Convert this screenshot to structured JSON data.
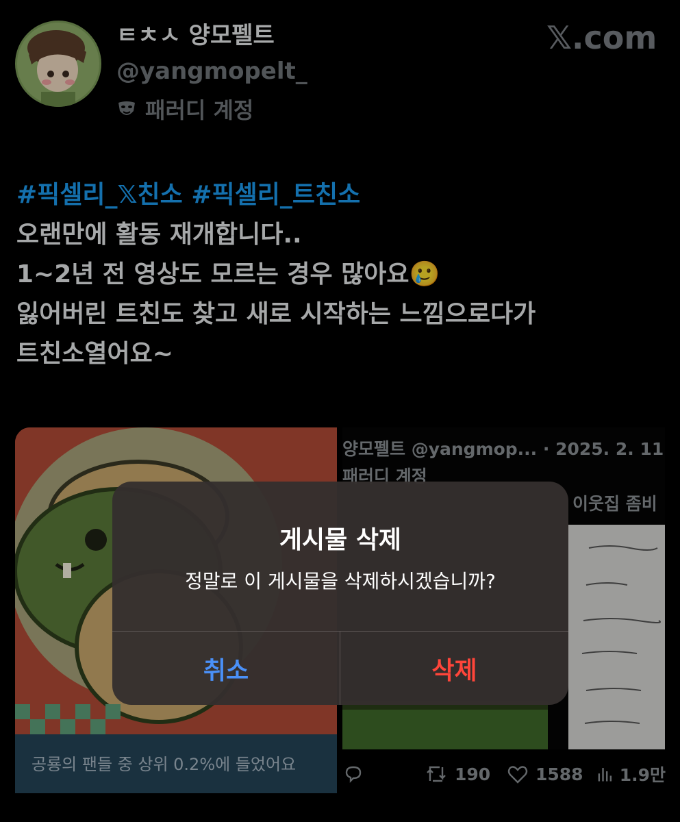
{
  "header": {
    "display_name": "ㅌㅊㅅ 양모펠트",
    "handle": "@yangmopelt_",
    "parody_label": "패러디 계정",
    "parody_icon": "theater-masks-icon",
    "brand": "𝕏.com"
  },
  "tweet": {
    "hashtag1": "#픽셀리_𝕏친소",
    "hashtag2": "#픽셀리_트친소",
    "line2": "오랜만에 활동 재개합니다..",
    "line3": "1~2년 전 영상도 모르는 경우 많아요",
    "line3_emoji": "🥲",
    "line4": "잃어버린 트친도 찾고 새로 시작하는 느낌으로다가",
    "line5": "트친소열어요~"
  },
  "media": {
    "fan_badge_text": "공룡의 팬들 중 상위 0.2%에 들었어요",
    "quote": {
      "header": "양모펠트 @yangmop... · 2025. 2. 11",
      "parody": "패러디 계정",
      "text_snippet": "이웃집 좀비"
    }
  },
  "actions": {
    "retweets": "190",
    "likes": "1588",
    "views": "1.9만"
  },
  "alert": {
    "title": "게시물 삭제",
    "message": "정말로 이 게시물을 삭제하시겠습니까?",
    "cancel_label": "취소",
    "delete_label": "삭제"
  },
  "colors": {
    "background": "#000000",
    "hashtag": "#1d9bf0",
    "muted": "#71767b",
    "cancel": "#4a90f7",
    "destructive": "#ff453a",
    "alert_bg": "#342f2e"
  }
}
